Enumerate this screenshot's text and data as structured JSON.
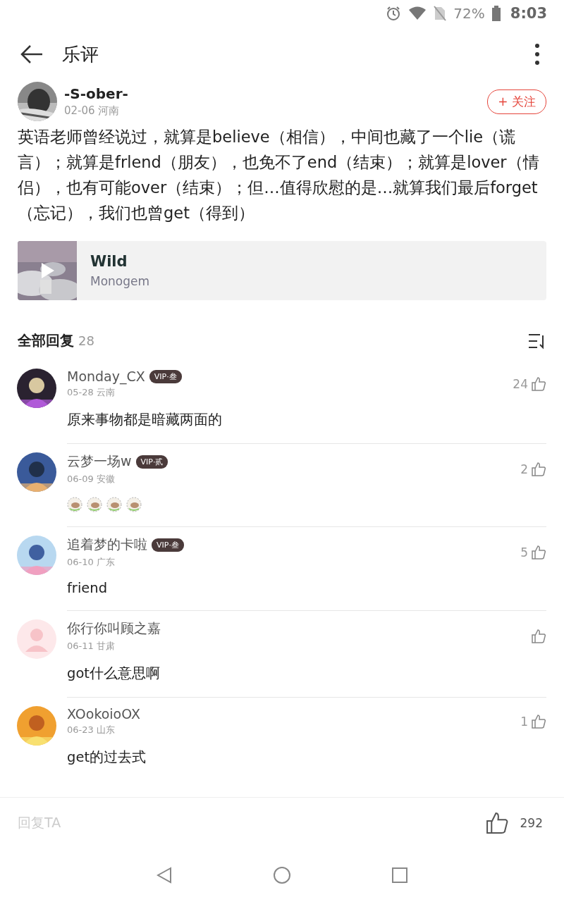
{
  "status_bar": {
    "battery": "72%",
    "time": "8:03"
  },
  "header": {
    "title": "乐评"
  },
  "post": {
    "author": "-S-ober-",
    "meta": "02-06 河南",
    "follow_label": "+ 关注",
    "text": "英语老师曾经说过，就算是believe（相信），中间也藏了一个lie（谎言）；就算是frlend（朋友），也免不了end（结束）；就算是lover（情侣），也有可能over（结束）；但…值得欣慰的是…就算我们最后forget（忘记），我们也曾get（得到）",
    "song": {
      "title": "Wild",
      "artist": "Monogem"
    }
  },
  "replies": {
    "heading": "全部回复",
    "count": "28"
  },
  "comments": [
    {
      "name": "Monday_CX",
      "badge": "VIP·叁",
      "meta": "05-28 云南",
      "kind": "text",
      "text": "原来事物都是暗藏两面的",
      "likes": "24",
      "default_avatar": false
    },
    {
      "name": "云梦一场w",
      "badge": "VIP·贰",
      "meta": "06-09 安徽",
      "kind": "stickers",
      "likes": "2",
      "default_avatar": false
    },
    {
      "name": "追着梦的卡啦",
      "badge": "VIP·叁",
      "meta": "06-10 广东",
      "kind": "text",
      "text": "friend",
      "likes": "5",
      "default_avatar": false
    },
    {
      "name": "你行你叫顾之嘉",
      "meta": "06-11 甘肃",
      "kind": "text",
      "text": "got什么意思啊",
      "default_avatar": true
    },
    {
      "name": "XOokoioOX",
      "meta": "06-23 山东",
      "kind": "text",
      "text": "get的过去式",
      "likes": "1",
      "default_avatar": false
    }
  ],
  "bottom_bar": {
    "placeholder": "回复TA",
    "likes": "292"
  }
}
